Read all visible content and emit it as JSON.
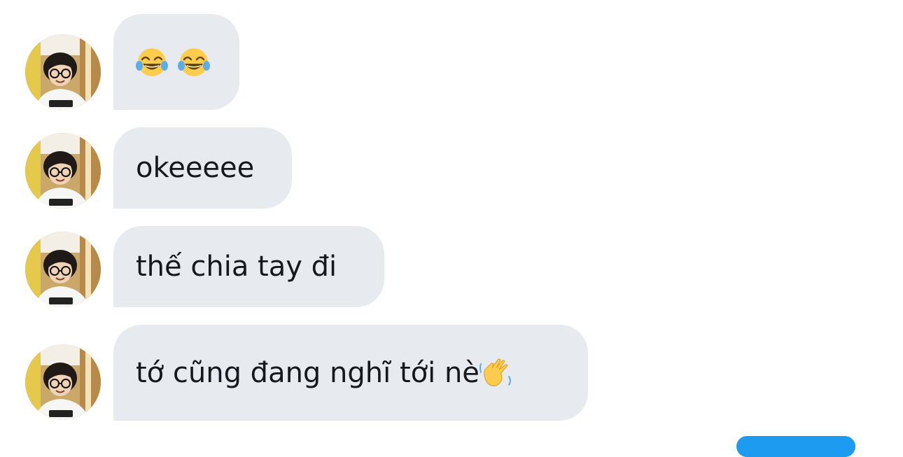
{
  "conversation": {
    "messages": [
      {
        "text": "",
        "emojis": [
          "face-with-tears-of-joy-icon",
          "face-with-tears-of-joy-icon"
        ]
      },
      {
        "text": "okeeeee"
      },
      {
        "text": "thế chia tay đi"
      },
      {
        "text": "tớ cũng đang nghĩ tới nè",
        "emoji": "waving-hand-icon"
      }
    ]
  },
  "colors": {
    "bubble_bg": "#e7ebf0",
    "text": "#16181c",
    "accent": "#1d9bf0"
  }
}
